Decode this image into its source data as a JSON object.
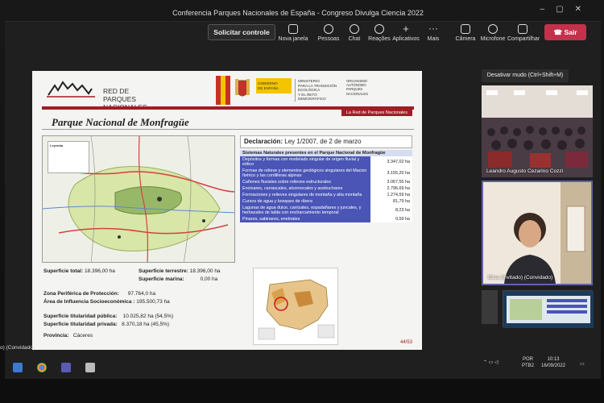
{
  "window": {
    "title": "Conferencia Parques Nacionales de España - Congreso Divulga Ciencia 2022"
  },
  "toolbar": {
    "request_control": "Solicitar controle",
    "items": [
      {
        "label": "Nova janela",
        "icon": "new-window-icon"
      },
      {
        "label": "Pessoas",
        "icon": "people-icon"
      },
      {
        "label": "Chat",
        "icon": "chat-icon"
      },
      {
        "label": "Reações",
        "icon": "reactions-icon"
      },
      {
        "label": "Aplicativos",
        "icon": "plus-icon"
      },
      {
        "label": "Mais",
        "icon": "more-icon"
      },
      {
        "label": "Câmera",
        "icon": "camera-icon"
      },
      {
        "label": "Microfone",
        "icon": "microphone-icon"
      },
      {
        "label": "Compartilhar",
        "icon": "share-icon"
      }
    ],
    "leave": "Sair",
    "mic_tooltip": "Desativar mudo (Ctrl+Shift+M)"
  },
  "slide": {
    "logo_line1": "RED DE",
    "logo_line2": "PARQUES NACIONALES",
    "gov_line1": "GOBIERNO",
    "gov_line2": "DE ESPAÑA",
    "ministry_line1": "MINISTERIO",
    "ministry_line2": "PARA LA TRANSICIÓN ECOLÓGICA",
    "ministry_line3": "Y EL RETO DEMOGRÁFICO",
    "org_line1": "ORGANISMO",
    "org_line2": "AUTÓNOMO",
    "org_line3": "PARQUES",
    "org_line4": "NACIONALES",
    "tag": "La Red de Parques Nacionales",
    "title": "Parque Nacional de Monfragüe",
    "declaration_label": "Declaración:",
    "declaration_value": "Ley 1/2007, de 2 de marzo",
    "legend_title": "Leyenda",
    "table_header": "Sistemas Naturales presentes en el Parque Nacional de Monfragüe",
    "table_rows": [
      {
        "label": "Depósitos y formas con modelado singular de origen fluvial y eólico",
        "value": "3.347,02 ha"
      },
      {
        "label": "Formas de relieve y elementos geológicos singulares del Macizo Ibérico y las cordilleras alpinas",
        "value": "3.155,20 ha"
      },
      {
        "label": "Cañones fluviales sobre relieves estructurales",
        "value": "3.067,55 ha"
      },
      {
        "label": "Encinares, carrascales, alcornocales y acebuchares",
        "value": "2.796,69 ha"
      },
      {
        "label": "Formaciones y relieves singulares de montaña y alta montaña",
        "value": "1.274,59 ha"
      },
      {
        "label": "Cursos de agua y bosques de ribera",
        "value": "81,79 ha"
      },
      {
        "label": "Lagunas de agua dulce, carrizales, espadañares y juncales, y herbazales de tabla con encharcamiento temporal",
        "value": "8,23 ha"
      },
      {
        "label": "Pinares, sabinares, enebrales",
        "value": "0,59 ha"
      }
    ],
    "stats": {
      "total_label": "Superficie total:",
      "total_value": "18.396,00 ha",
      "land_label": "Superficie terrestre:",
      "land_value": "18.396,00 ha",
      "marine_label": "Superficie marina:",
      "marine_value": "0,00 ha",
      "peripheral_label": "Zona Periférica de Protección:",
      "peripheral_value": "97.764,0 ha",
      "influence_label": "Área de Influencia Socioeconómica :",
      "influence_value": "195.500,73 ha",
      "public_label": "Superficie titularidad pública:",
      "public_value": "10.025,82 ha (54,5%)",
      "private_label": "Superficie titularidad privada:",
      "private_value": "8.370,18 ha (45,5%)",
      "province_label": "Provincia:",
      "province_value": "Cáceres"
    },
    "page": "44/53"
  },
  "participants": [
    {
      "name": "Leandro Augusto Cezarino Cozzi"
    },
    {
      "name": "Elisa (Invitado) (Convidado)"
    }
  ],
  "left_label": "o) (Convidado)",
  "tray": {
    "lang1": "POR",
    "lang2": "PTB2",
    "time": "10:13",
    "date": "16/09/2022"
  },
  "colors": {
    "leave": "#c4314b",
    "accent": "#6264a7",
    "slide_red": "#a11d24",
    "table_blue": "#4a55b6"
  }
}
